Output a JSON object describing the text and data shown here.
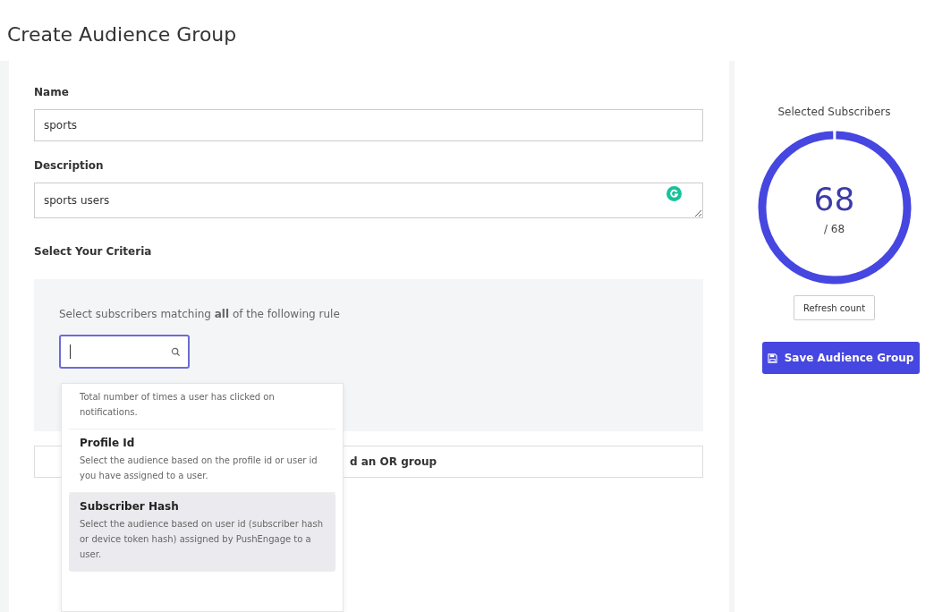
{
  "page_title": "Create Audience Group",
  "form": {
    "name": {
      "label": "Name",
      "value": "sports"
    },
    "description": {
      "label": "Description",
      "value": "sports users"
    },
    "criteria_label": "Select Your Criteria",
    "rule_text": "Select subscribers matching **all** of the following rule",
    "search": {
      "focused": true
    },
    "or_group_button": "d an OR group",
    "dropdown": [
      {
        "description": "Total number of times a user has clicked on notifications.",
        "selected": false
      },
      {
        "title": "Profile Id",
        "description": "Select the audience based on the profile id or user id you have assigned to a user.",
        "selected": false
      },
      {
        "title": "Subscriber Hash",
        "description": "Select the audience based on user id (subscriber hash or device token hash) assigned by PushEngage to a user.",
        "selected": true
      }
    ]
  },
  "summary": {
    "title": "Selected Subscribers",
    "count": "68",
    "total": "/ 68",
    "level": 1,
    "refresh_button": "Refresh count",
    "save_button": "Save Audience Group"
  }
}
